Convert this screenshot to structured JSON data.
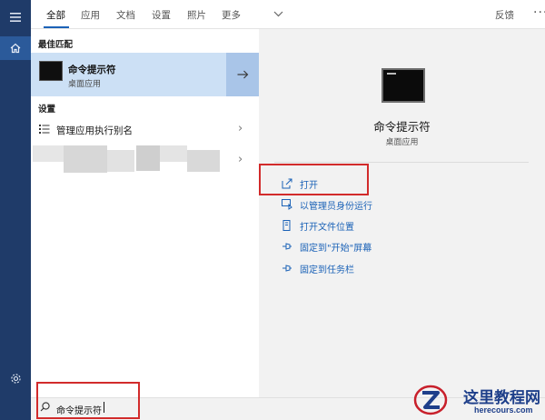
{
  "tabs": [
    {
      "label": "全部"
    },
    {
      "label": "应用"
    },
    {
      "label": "文档"
    },
    {
      "label": "设置"
    },
    {
      "label": "照片"
    },
    {
      "label": "更多"
    }
  ],
  "header": {
    "feedback_label": "反馈",
    "more_options": "···"
  },
  "best_match": {
    "section_title": "最佳匹配",
    "title": "命令提示符",
    "subtitle": "桌面应用"
  },
  "settings": {
    "section_title": "设置",
    "items": [
      {
        "label": "管理应用执行别名"
      }
    ]
  },
  "detail": {
    "title": "命令提示符",
    "subtitle": "桌面应用",
    "actions": [
      {
        "label": "打开",
        "icon": "open-icon"
      },
      {
        "label": "以管理员身份运行",
        "icon": "run-as-admin-icon"
      },
      {
        "label": "打开文件位置",
        "icon": "file-location-icon"
      },
      {
        "label": "固定到\"开始\"屏幕",
        "icon": "pin-start-icon"
      },
      {
        "label": "固定到任务栏",
        "icon": "pin-taskbar-icon"
      }
    ]
  },
  "search": {
    "value": "命令提示符"
  },
  "watermark": {
    "title": "这里教程网",
    "url": "herecours.com"
  },
  "colors": {
    "rail": "#1f3b69",
    "accent": "#1b62b7",
    "selected": "#cce0f5",
    "highlight_box": "#d22b2b"
  }
}
